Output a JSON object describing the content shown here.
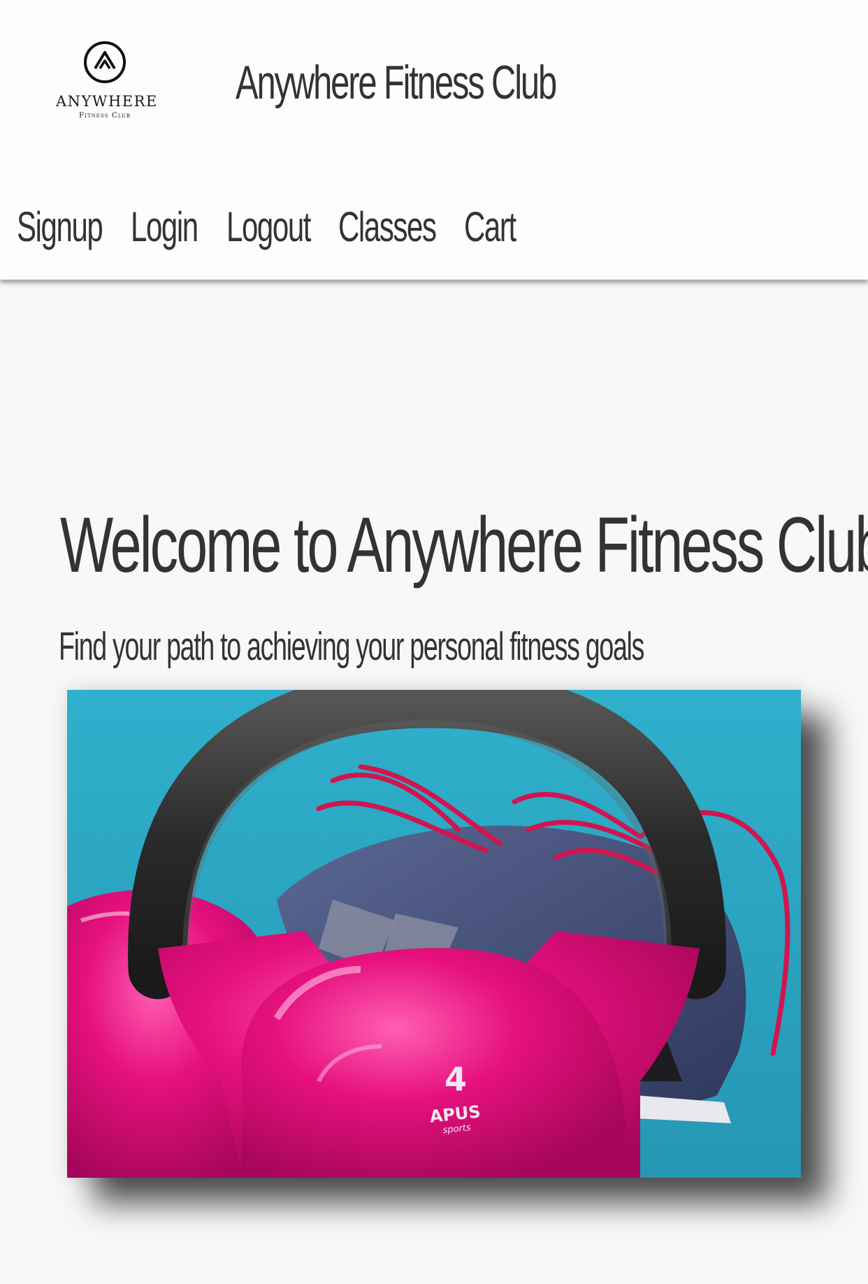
{
  "header": {
    "logo_text": "ANYWHERE",
    "logo_subtext": "Fitness Club",
    "site_title": "Anywhere Fitness Club"
  },
  "nav": {
    "items": [
      {
        "label": "Signup"
      },
      {
        "label": "Login"
      },
      {
        "label": "Logout"
      },
      {
        "label": "Classes"
      },
      {
        "label": "Cart"
      }
    ]
  },
  "hero": {
    "title": "Welcome to Anywhere Fitness Club",
    "subtitle": "Find your path to achieving your personal fitness goals",
    "image": {
      "kettlebell_weight": "4",
      "kettlebell_brand": "APUS",
      "kettlebell_brand_sub": "sports",
      "colors": {
        "background": "#2aa5c2",
        "kettlebell": "#e6107e",
        "handle": "#2b2b2b",
        "shoe": "#44507a",
        "laces": "#d0154f"
      }
    }
  },
  "colors": {
    "page_background": "#f8f8f8",
    "text": "#333333"
  }
}
